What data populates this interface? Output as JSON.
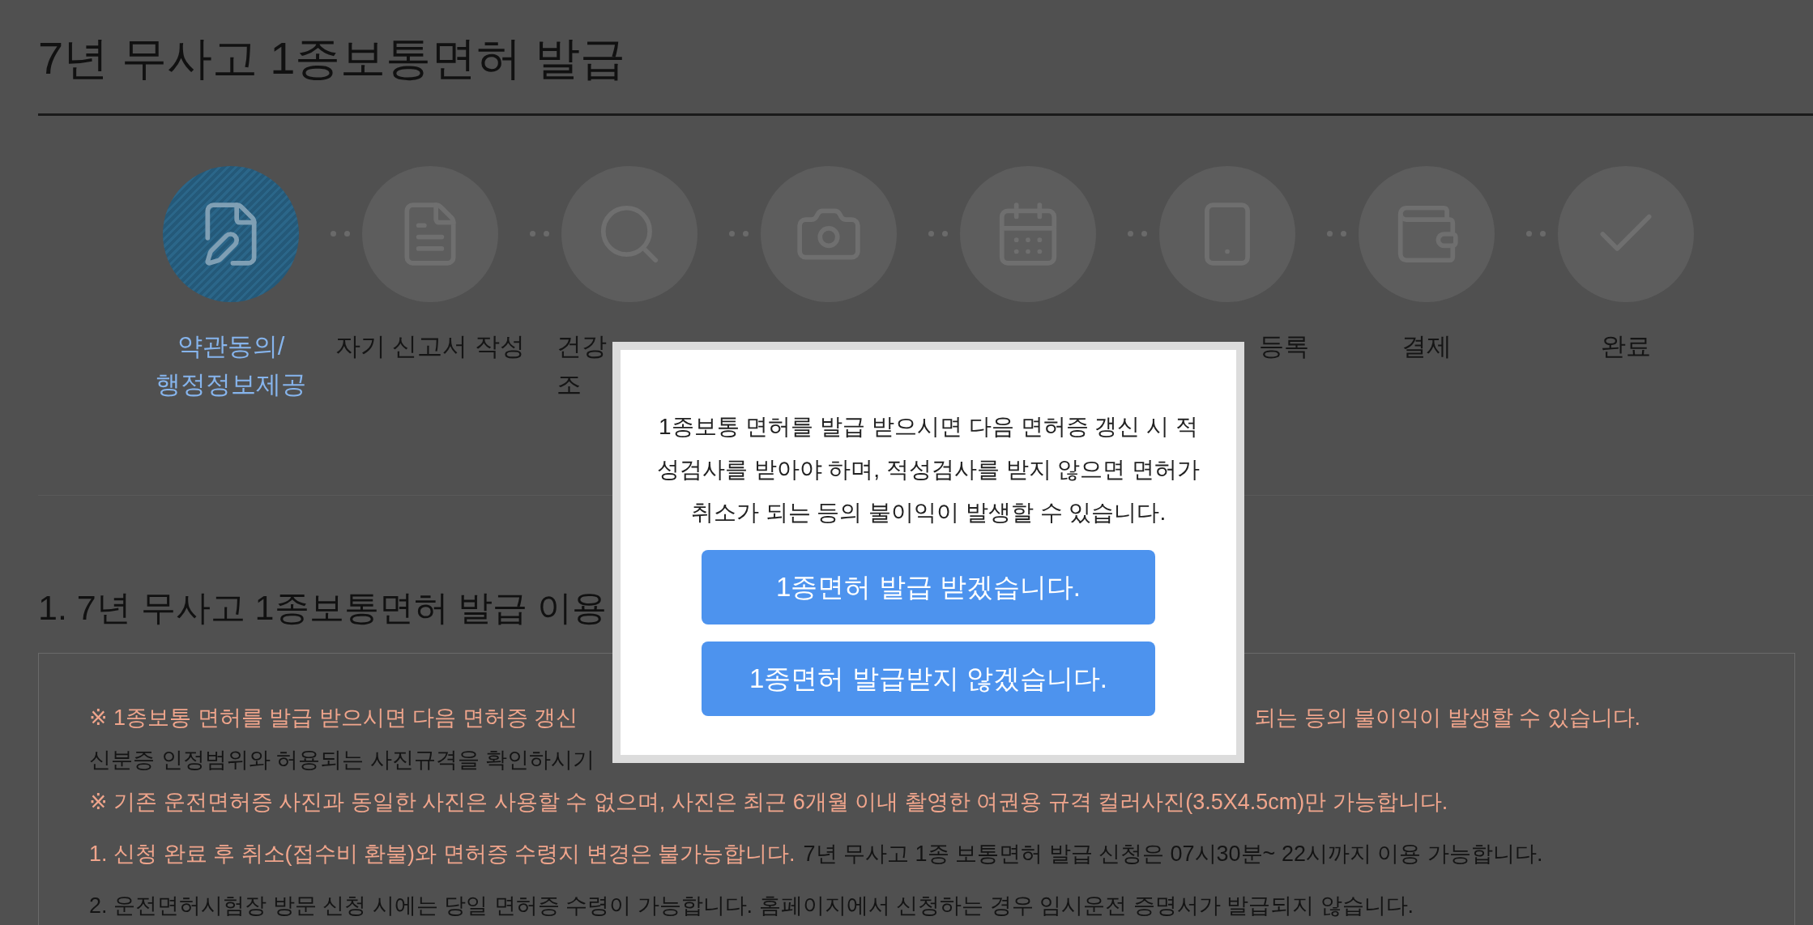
{
  "page_title": "7년 무사고 1종보통면허 발급",
  "steps": [
    {
      "label": [
        "약관동의/",
        "행정정보제공"
      ],
      "selected": true
    },
    {
      "label": [
        "자기 신고서 작성"
      ],
      "selected": false
    },
    {
      "label": [
        "건강",
        "조"
      ],
      "selected": false
    },
    {
      "selected": false
    },
    {
      "selected": false
    },
    {
      "label": [
        "등록"
      ],
      "selected": false
    },
    {
      "label": [
        "결제"
      ],
      "selected": false
    },
    {
      "label": [
        "완료"
      ],
      "selected": false
    }
  ],
  "section_heading": "1. 7년 무사고 1종보통면허 발급 이용",
  "notice_lines": [
    {
      "segments": [
        {
          "text": "※ 1종보통 면허를 발급 받으시면 다음 면허증 갱신",
          "warning": true
        }
      ],
      "trailing": {
        "text": "되는 등의 불이익이 발생할 수 있습니다.",
        "warning": true
      }
    },
    {
      "segments": [
        {
          "text": "신분증 인정범위와 허용되는 사진규격을 확인하시기",
          "warning": false
        }
      ]
    },
    {
      "segments": [
        {
          "text": "※ 기존 운전면허증 사진과 동일한 사진은 사용할 수 없으며, 사진은 최근 6개월 이내 촬영한 여권용 규격 컬러사진(3.5X4.5cm)만 가능합니다.",
          "warning": true
        }
      ]
    },
    {
      "segments": [
        {
          "text": "1. 신청 완료 후 취소(접수비 환불)와 면허증 수령지 변경은 불가능합니다.",
          "warning": true
        },
        {
          "text": "7년 무사고 1종 보통면허 발급 신청은 07시30분~ 22시까지 이용 가능합니다.",
          "warning": false
        }
      ]
    },
    {
      "segments": [
        {
          "text": "2. 운전면허시험장 방문 신청 시에는 당일 면허증 수령이 가능합니다. 홈페이지에서 신청하는 경우 임시운전 증명서가 발급되지 않습니다.",
          "warning": false
        }
      ]
    }
  ],
  "modal": {
    "message": "1종보통 면허를 발급 받으시면 다음 면허증 갱신 시 적성검사를 받아야 하며, 적성검사를 받지 않으면 면허가 취소가 되는 등의 불이익이 발생할 수 있습니다.",
    "buttons": [
      "1종면허 발급 받겠습니다.",
      "1종면허 발급받지 않겠습니다."
    ]
  }
}
